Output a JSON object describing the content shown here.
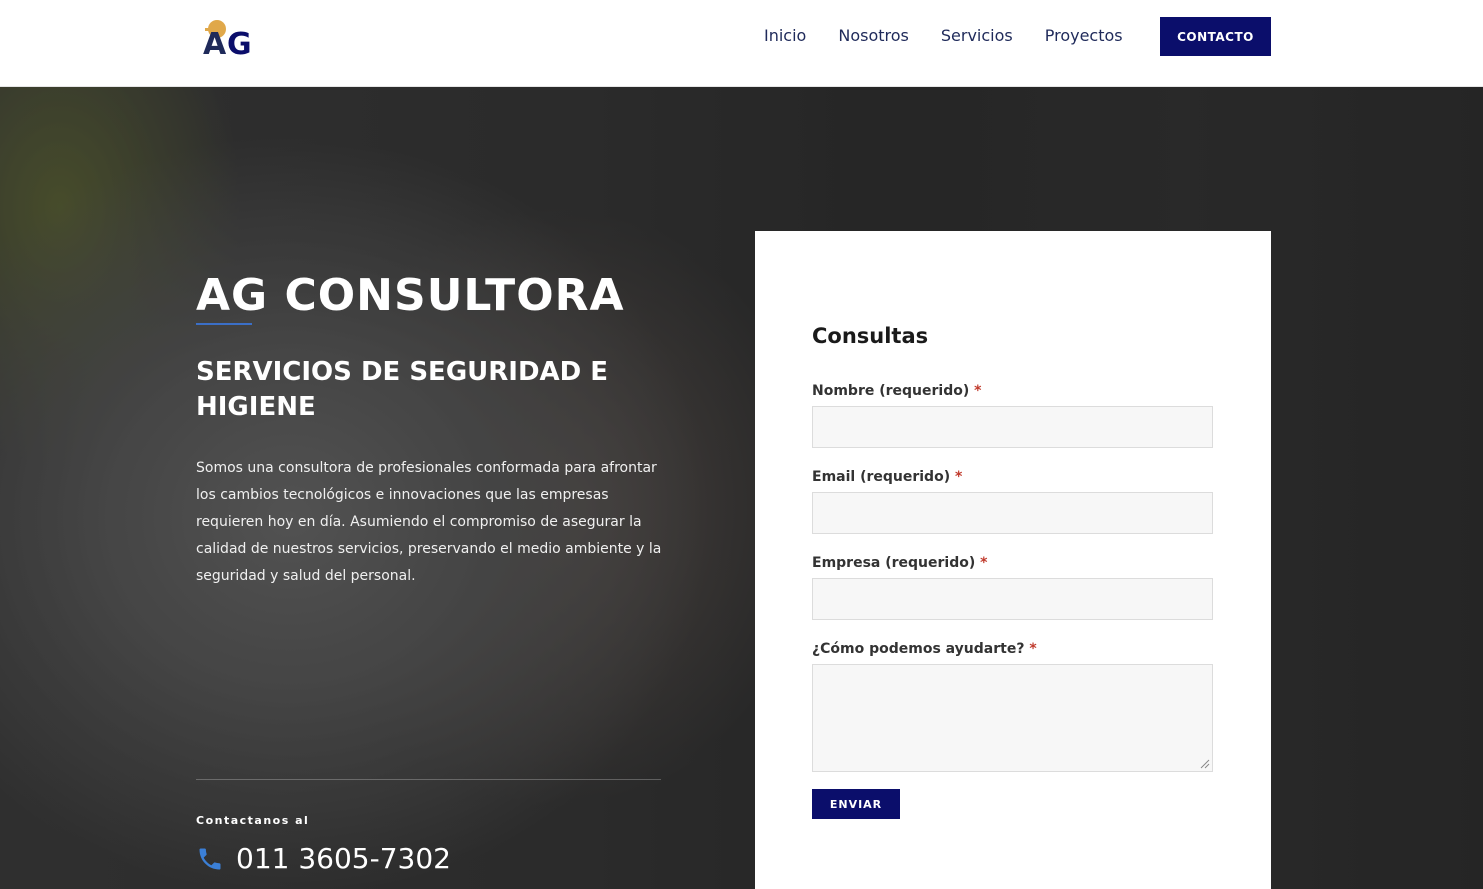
{
  "header": {
    "logo_text": "AG",
    "nav": [
      {
        "label": "Inicio"
      },
      {
        "label": "Nosotros"
      },
      {
        "label": "Servicios"
      },
      {
        "label": "Proyectos"
      }
    ],
    "cta_label": "CONTACTO"
  },
  "hero": {
    "title": "AG CONSULTORA",
    "subtitle": "SERVICIOS DE SEGURIDAD E HIGIENE",
    "description": "Somos una consultora de profesionales conformada para afrontar los cambios tecnológicos e innovaciones que las empresas requieren hoy en día. Asumiendo el compromiso de asegurar la calidad de nuestros servicios, preservando el medio ambiente y la seguridad y salud del personal.",
    "contact_label": "Contactanos al",
    "phone": "011 3605-7302",
    "phone_icon": "phone-icon"
  },
  "form": {
    "title": "Consultas",
    "fields": [
      {
        "label": "Nombre (requerido)",
        "required_mark": "*",
        "value": ""
      },
      {
        "label": "Email (requerido)",
        "required_mark": "*",
        "value": ""
      },
      {
        "label": "Empresa (requerido)",
        "required_mark": "*",
        "value": ""
      },
      {
        "label": "¿Cómo podemos ayudarte?",
        "required_mark": "*",
        "value": ""
      }
    ],
    "submit_label": "ENVIAR"
  },
  "colors": {
    "brand_navy": "#0b0e6b",
    "nav_text": "#1f2a5a",
    "accent_blue": "#3b6fc7",
    "required": "#c0392b",
    "logo_gold": "#e0a84a"
  }
}
